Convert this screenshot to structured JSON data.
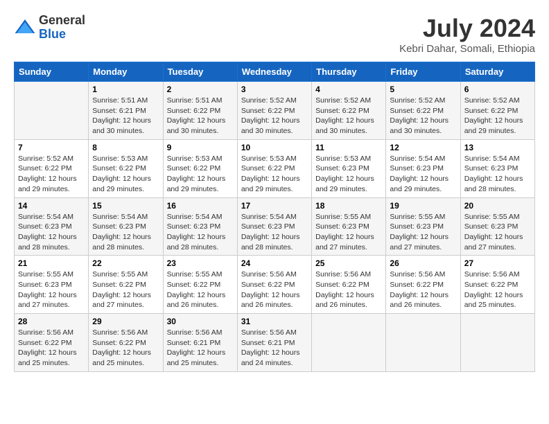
{
  "logo": {
    "general": "General",
    "blue": "Blue"
  },
  "header": {
    "month_year": "July 2024",
    "location": "Kebri Dahar, Somali, Ethiopia"
  },
  "weekdays": [
    "Sunday",
    "Monday",
    "Tuesday",
    "Wednesday",
    "Thursday",
    "Friday",
    "Saturday"
  ],
  "weeks": [
    [
      {
        "day": "",
        "info": ""
      },
      {
        "day": "1",
        "info": "Sunrise: 5:51 AM\nSunset: 6:21 PM\nDaylight: 12 hours\nand 30 minutes."
      },
      {
        "day": "2",
        "info": "Sunrise: 5:51 AM\nSunset: 6:22 PM\nDaylight: 12 hours\nand 30 minutes."
      },
      {
        "day": "3",
        "info": "Sunrise: 5:52 AM\nSunset: 6:22 PM\nDaylight: 12 hours\nand 30 minutes."
      },
      {
        "day": "4",
        "info": "Sunrise: 5:52 AM\nSunset: 6:22 PM\nDaylight: 12 hours\nand 30 minutes."
      },
      {
        "day": "5",
        "info": "Sunrise: 5:52 AM\nSunset: 6:22 PM\nDaylight: 12 hours\nand 30 minutes."
      },
      {
        "day": "6",
        "info": "Sunrise: 5:52 AM\nSunset: 6:22 PM\nDaylight: 12 hours\nand 29 minutes."
      }
    ],
    [
      {
        "day": "7",
        "info": "Sunrise: 5:52 AM\nSunset: 6:22 PM\nDaylight: 12 hours\nand 29 minutes."
      },
      {
        "day": "8",
        "info": "Sunrise: 5:53 AM\nSunset: 6:22 PM\nDaylight: 12 hours\nand 29 minutes."
      },
      {
        "day": "9",
        "info": "Sunrise: 5:53 AM\nSunset: 6:22 PM\nDaylight: 12 hours\nand 29 minutes."
      },
      {
        "day": "10",
        "info": "Sunrise: 5:53 AM\nSunset: 6:22 PM\nDaylight: 12 hours\nand 29 minutes."
      },
      {
        "day": "11",
        "info": "Sunrise: 5:53 AM\nSunset: 6:23 PM\nDaylight: 12 hours\nand 29 minutes."
      },
      {
        "day": "12",
        "info": "Sunrise: 5:54 AM\nSunset: 6:23 PM\nDaylight: 12 hours\nand 29 minutes."
      },
      {
        "day": "13",
        "info": "Sunrise: 5:54 AM\nSunset: 6:23 PM\nDaylight: 12 hours\nand 28 minutes."
      }
    ],
    [
      {
        "day": "14",
        "info": "Sunrise: 5:54 AM\nSunset: 6:23 PM\nDaylight: 12 hours\nand 28 minutes."
      },
      {
        "day": "15",
        "info": "Sunrise: 5:54 AM\nSunset: 6:23 PM\nDaylight: 12 hours\nand 28 minutes."
      },
      {
        "day": "16",
        "info": "Sunrise: 5:54 AM\nSunset: 6:23 PM\nDaylight: 12 hours\nand 28 minutes."
      },
      {
        "day": "17",
        "info": "Sunrise: 5:54 AM\nSunset: 6:23 PM\nDaylight: 12 hours\nand 28 minutes."
      },
      {
        "day": "18",
        "info": "Sunrise: 5:55 AM\nSunset: 6:23 PM\nDaylight: 12 hours\nand 27 minutes."
      },
      {
        "day": "19",
        "info": "Sunrise: 5:55 AM\nSunset: 6:23 PM\nDaylight: 12 hours\nand 27 minutes."
      },
      {
        "day": "20",
        "info": "Sunrise: 5:55 AM\nSunset: 6:23 PM\nDaylight: 12 hours\nand 27 minutes."
      }
    ],
    [
      {
        "day": "21",
        "info": "Sunrise: 5:55 AM\nSunset: 6:23 PM\nDaylight: 12 hours\nand 27 minutes."
      },
      {
        "day": "22",
        "info": "Sunrise: 5:55 AM\nSunset: 6:22 PM\nDaylight: 12 hours\nand 27 minutes."
      },
      {
        "day": "23",
        "info": "Sunrise: 5:55 AM\nSunset: 6:22 PM\nDaylight: 12 hours\nand 26 minutes."
      },
      {
        "day": "24",
        "info": "Sunrise: 5:56 AM\nSunset: 6:22 PM\nDaylight: 12 hours\nand 26 minutes."
      },
      {
        "day": "25",
        "info": "Sunrise: 5:56 AM\nSunset: 6:22 PM\nDaylight: 12 hours\nand 26 minutes."
      },
      {
        "day": "26",
        "info": "Sunrise: 5:56 AM\nSunset: 6:22 PM\nDaylight: 12 hours\nand 26 minutes."
      },
      {
        "day": "27",
        "info": "Sunrise: 5:56 AM\nSunset: 6:22 PM\nDaylight: 12 hours\nand 25 minutes."
      }
    ],
    [
      {
        "day": "28",
        "info": "Sunrise: 5:56 AM\nSunset: 6:22 PM\nDaylight: 12 hours\nand 25 minutes."
      },
      {
        "day": "29",
        "info": "Sunrise: 5:56 AM\nSunset: 6:22 PM\nDaylight: 12 hours\nand 25 minutes."
      },
      {
        "day": "30",
        "info": "Sunrise: 5:56 AM\nSunset: 6:21 PM\nDaylight: 12 hours\nand 25 minutes."
      },
      {
        "day": "31",
        "info": "Sunrise: 5:56 AM\nSunset: 6:21 PM\nDaylight: 12 hours\nand 24 minutes."
      },
      {
        "day": "",
        "info": ""
      },
      {
        "day": "",
        "info": ""
      },
      {
        "day": "",
        "info": ""
      }
    ]
  ]
}
